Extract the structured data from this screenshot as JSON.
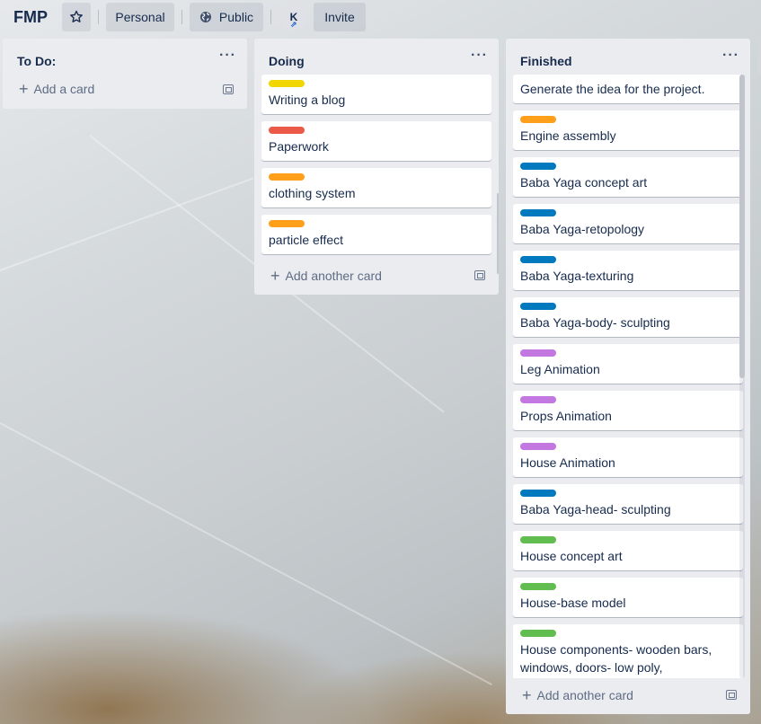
{
  "header": {
    "board_title": "FMP",
    "personal_label": "Personal",
    "visibility_label": "Public",
    "member_initial": "K",
    "invite_label": "Invite"
  },
  "lists": {
    "todo": {
      "title": "To Do:",
      "add_label": "Add a card",
      "cards": []
    },
    "doing": {
      "title": "Doing",
      "add_label": "Add another card",
      "cards": [
        {
          "text": "Writing a blog",
          "label_color": "#f2d600"
        },
        {
          "text": "Paperwork",
          "label_color": "#eb5a46"
        },
        {
          "text": "clothing system",
          "label_color": "#ff9f1a"
        },
        {
          "text": "particle effect",
          "label_color": "#ff9f1a"
        }
      ]
    },
    "finished": {
      "title": "Finished",
      "add_label": "Add another card",
      "cards": [
        {
          "text": "Generate the idea for the project.",
          "label_color": null
        },
        {
          "text": "Engine assembly",
          "label_color": "#ff9f1a"
        },
        {
          "text": "Baba Yaga concept art",
          "label_color": "#0079bf"
        },
        {
          "text": "Baba Yaga-retopology",
          "label_color": "#0079bf"
        },
        {
          "text": "Baba Yaga-texturing",
          "label_color": "#0079bf"
        },
        {
          "text": "Baba Yaga-body- sculpting",
          "label_color": "#0079bf"
        },
        {
          "text": "Leg Animation",
          "label_color": "#c377e0"
        },
        {
          "text": "Props Animation",
          "label_color": "#c377e0"
        },
        {
          "text": "House Animation",
          "label_color": "#c377e0"
        },
        {
          "text": "Baba Yaga-head- sculpting",
          "label_color": "#0079bf"
        },
        {
          "text": "House concept art",
          "label_color": "#61bd4f"
        },
        {
          "text": "House-base model",
          "label_color": "#61bd4f"
        },
        {
          "text": "House components- wooden bars, windows, doors- low poly,",
          "line1": "House components- wooden bars,",
          "line2": "windows, doors- low poly,",
          "label_color": "#61bd4f"
        }
      ]
    }
  },
  "icons": {
    "star": "star-icon",
    "globe": "globe-icon",
    "menu": "ellipsis-icon",
    "plus": "plus-icon",
    "template": "card-template-icon"
  }
}
